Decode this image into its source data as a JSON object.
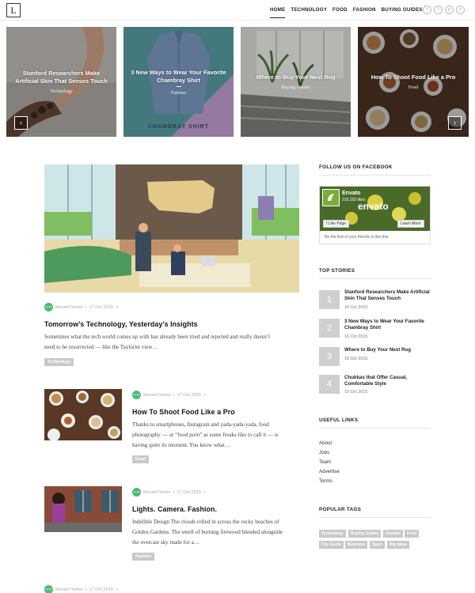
{
  "header": {
    "logo_letter": "L",
    "nav": [
      "HOME",
      "TECHNOLOGY",
      "FOOD",
      "FASHION",
      "BUYING GUIDES"
    ],
    "social_icons": [
      "twitter-icon",
      "facebook-icon",
      "pinterest-icon",
      "vk-icon"
    ]
  },
  "slider": {
    "slides": [
      {
        "title": "Stanford Researchers Make Artificial Skin That Senses Touch",
        "category": "Technology"
      },
      {
        "title": "3 New Ways to Wear Your Favorite Chambray Shirt",
        "category": "Fashion",
        "overlay_text": "CHAMBRAY SHIRT"
      },
      {
        "title": "Where to Buy Your Next Rug",
        "category": "Buying Guides"
      },
      {
        "title": "How To Shoot Food Like a Pro",
        "category": "Food"
      }
    ],
    "prev_glyph": "‹",
    "next_glyph": "›"
  },
  "posts": [
    {
      "author": "MondoTheme",
      "date": "17 Oct 2015",
      "title": "Tomorrow’s Technology, Yesterday’s Insights",
      "excerpt_1": "Sometimes what the tech world comes up with has already been tried and rejected and really doesn’t",
      "excerpt_2": "need to be resurrected — like the Taylorist view…",
      "tag": "Technology"
    },
    {
      "author": "MondoTheme",
      "date": "17 Oct 2015",
      "title": "How To Shoot Food Like a Pro",
      "excerpt_1": "Thanks to smartphones, Instagram and yada-yada-yada, food",
      "excerpt_2": "photography — or “food porn” as some freaks like to call it — is",
      "excerpt_3": "having quite its moment. You know what…",
      "tag": "Food"
    },
    {
      "author": "MondoTheme",
      "date": "17 Oct 2015",
      "title": "Lights. Camera. Fashion.",
      "excerpt_1": "Indelible Design The clouds rolled in across the rocky beaches of",
      "excerpt_2": "Golden Gardens. The smell of burning firewood blended alongside",
      "excerpt_3": "the overcast sky made for a…",
      "tag": "Fashion"
    },
    {
      "author": "MondoTheme",
      "date": "17 Oct 2015"
    }
  ],
  "sidebar": {
    "facebook": {
      "heading": "FOLLOW US ON FACEBOOK",
      "page_name": "Envato",
      "likes": "210,153 likes",
      "brand_word": "envato",
      "like_button": "Like Page",
      "learn_button": "Learn More",
      "friends_text": "Be the first of your friends to like this"
    },
    "top_stories": {
      "heading": "TOP STORIES",
      "items": [
        {
          "num": "1",
          "title": "Stanford Researchers Make Artificial Skin That Senses Touch",
          "date": "16 Oct 2015"
        },
        {
          "num": "2",
          "title": "3 New Ways to Wear Your Favorite Chambray Shirt",
          "date": "16 Oct 2015"
        },
        {
          "num": "3",
          "title": "Where to Buy Your Next Rug",
          "date": "15 Oct 2015"
        },
        {
          "num": "4",
          "title": "Chukkas that Offer Casual, Comfortable Style",
          "date": "15 Oct 2015"
        }
      ]
    },
    "useful_links": {
      "heading": "USEFUL LINKS",
      "items": [
        "About",
        "Jobs",
        "Team",
        "Advertise",
        "Terms"
      ]
    },
    "popular_tags": {
      "heading": "POPULAR TAGS",
      "items": [
        "Technology",
        "Buying Guides",
        "Fashion",
        "Food",
        "City Guide",
        "Business",
        "Sport",
        "Big Ideas"
      ]
    }
  },
  "colors": {
    "accent_green": "#4fba7a",
    "tag_gray": "#c9c9c9",
    "number_gray": "#cfcfcf"
  }
}
